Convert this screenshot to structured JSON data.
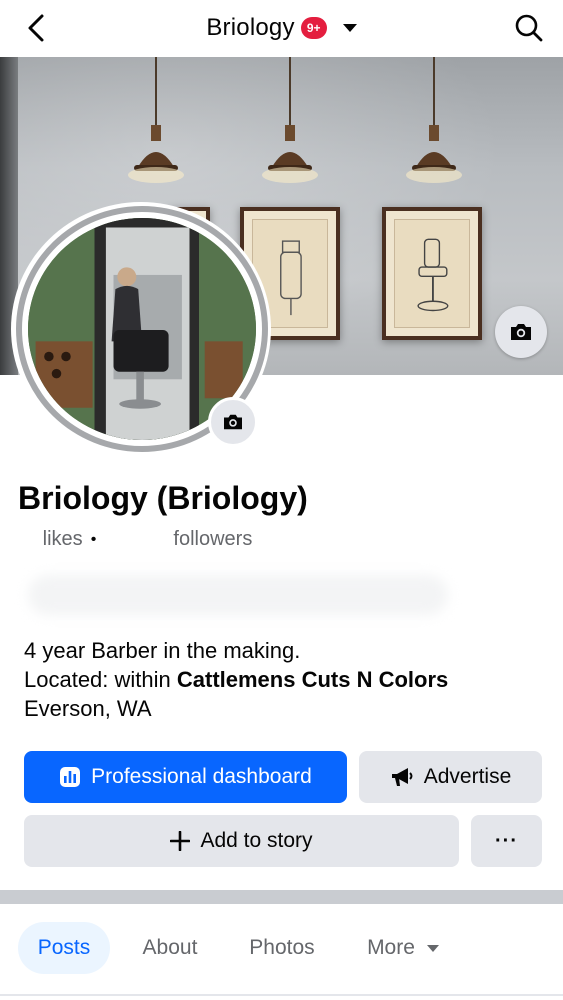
{
  "header": {
    "title": "Briology",
    "notification_badge": "9+",
    "back_icon": "chevron-left-icon",
    "search_icon": "search-icon"
  },
  "profile": {
    "name": "Briology (Briology)",
    "likes_label": "likes",
    "followers_label": "followers",
    "separator": "•"
  },
  "bio": {
    "line1": "4 year Barber in the making.",
    "line2_prefix": "Located: within ",
    "line2_place": "Cattlemens Cuts N Colors",
    "line3": "Everson, WA"
  },
  "actions": {
    "professional_dashboard": "Professional dashboard",
    "advertise": "Advertise",
    "add_to_story": "Add to story",
    "more": "···"
  },
  "tabs": [
    {
      "label": "Posts",
      "active": true
    },
    {
      "label": "About",
      "active": false
    },
    {
      "label": "Photos",
      "active": false
    },
    {
      "label": "More",
      "active": false
    }
  ],
  "colors": {
    "primary": "#0866ff",
    "badge": "#e41e3f",
    "button_gray": "#e4e6eb",
    "secondary_text": "#65676b"
  }
}
